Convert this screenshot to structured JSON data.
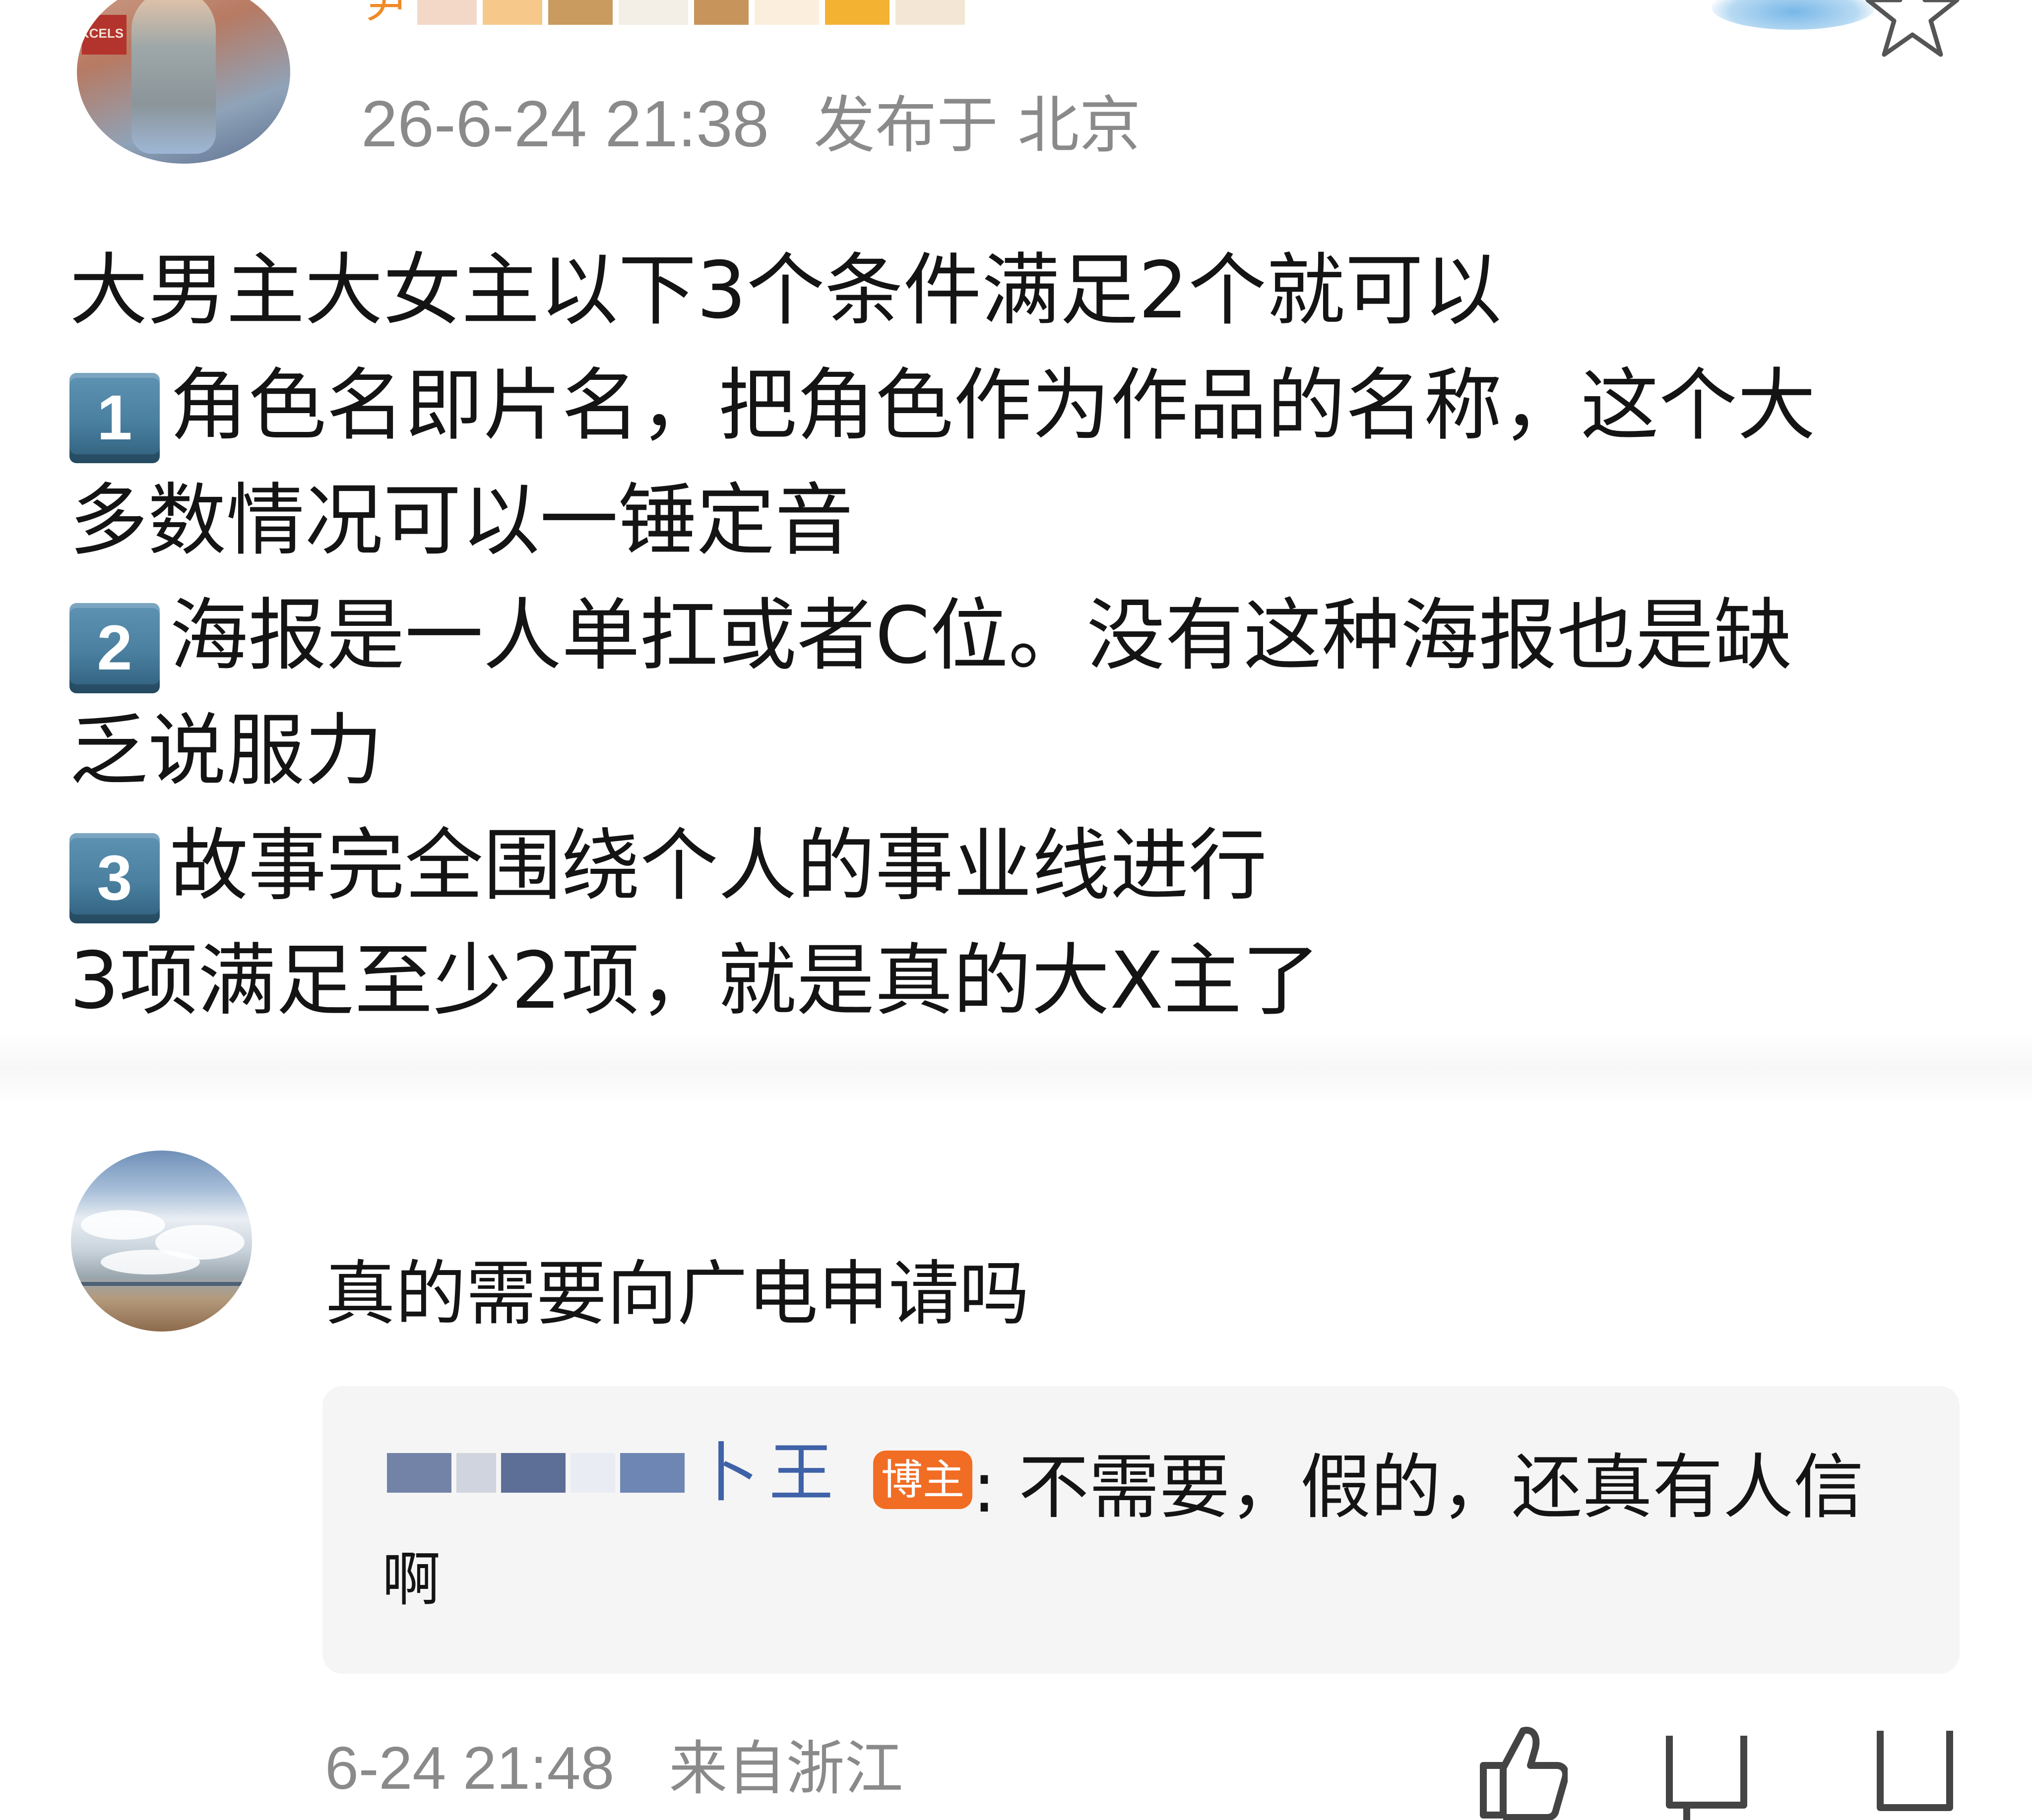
{
  "post": {
    "author_partial_glyph": "尹",
    "timestamp": "26-6-24 21:38",
    "location": "发布于 北京",
    "avatar_sign_text": "KCELS",
    "lines": [
      {
        "keycap": "",
        "text": "大男主大女主以下3个条件满足2个就可以"
      },
      {
        "keycap": "1",
        "text": "角色名即片名，把角色作为作品的名称，这个大"
      },
      {
        "keycap": "",
        "text": "多数情况可以一锤定音"
      },
      {
        "keycap": "2",
        "text": "海报是一人单扛或者C位。没有这种海报也是缺"
      },
      {
        "keycap": "",
        "text": "乏说服力"
      },
      {
        "keycap": "3",
        "text": "故事完全围绕个人的事业线进行"
      },
      {
        "keycap": "",
        "text": "3项满足至少2项，就是真的大X主了"
      }
    ]
  },
  "comment": {
    "text": "真的需要向广电申请吗",
    "reply": {
      "author_partial_glyph_1": "卜",
      "author_partial_glyph_2": "王",
      "badge": "博主",
      "line1": ": 不需要，假的，还真有人信",
      "line2": "啊"
    },
    "timestamp": "6-24 21:48",
    "from": "来自浙江"
  },
  "icons": {
    "star": "star-icon",
    "like": "thumbs-up-icon",
    "reply": "comment-icon",
    "share": "share-icon"
  },
  "colors": {
    "username": "#ef8a28",
    "meta": "#8a8a8a",
    "badge": "#f16d24",
    "reply_author": "#3f62a8",
    "keycap": "#4a7f9f"
  }
}
